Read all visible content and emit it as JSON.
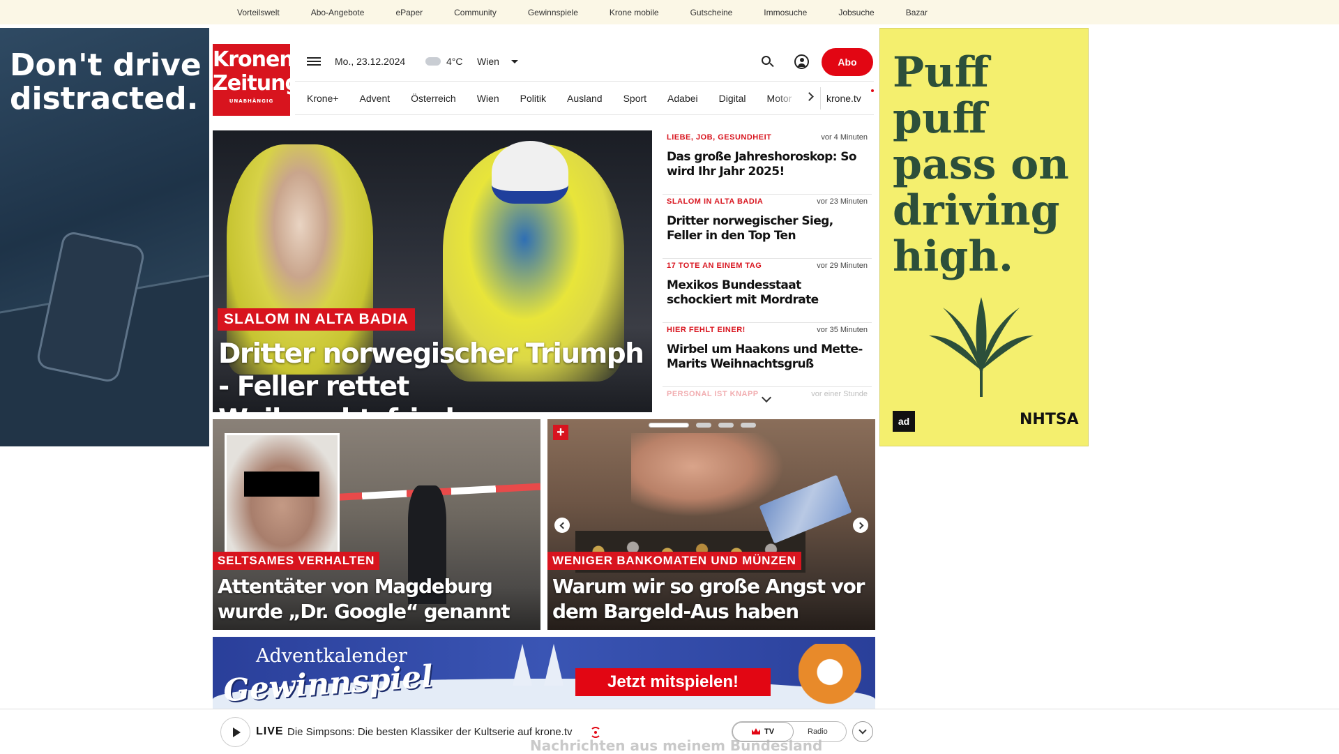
{
  "topbar": {
    "items": [
      "Vorteilswelt",
      "Abo-Angebote",
      "ePaper",
      "Community",
      "Gewinnspiele",
      "Krone mobile",
      "Gutscheine",
      "Immosuche",
      "Jobsuche",
      "Bazar"
    ]
  },
  "ad_left": {
    "title": "Don't drive distracted."
  },
  "ad_right": {
    "title": "Puff puff pass on driving high.",
    "badge": "ad",
    "brand": "NHTSA"
  },
  "header": {
    "logo_line1": "Kronen",
    "logo_line2": "Zeitung",
    "logo_tagline": "UNABHÄNGIG",
    "date": "Mo., 23.12.2024",
    "temperature": "4°C",
    "city": "Wien",
    "abo_label": "Abo"
  },
  "nav": {
    "items": [
      "Krone+",
      "Advent",
      "Österreich",
      "Wien",
      "Politik",
      "Ausland",
      "Sport",
      "Adabei",
      "Digital",
      "Motor"
    ],
    "extra": "krone.tv"
  },
  "hero": {
    "kicker": "SLALOM IN ALTA BADIA",
    "headline": "Dritter norwegischer Triumph - Feller rettet Weihnachtsfrieden"
  },
  "news_list": [
    {
      "kicker": "LIEBE, JOB, GESUNDHEIT",
      "time": "vor 4 Minuten",
      "title": "Das große Jahreshoroskop: So wird Ihr Jahr 2025!"
    },
    {
      "kicker": "SLALOM IN ALTA BADIA",
      "time": "vor 23 Minuten",
      "title": "Dritter norwegischer Sieg, Feller in den Top Ten"
    },
    {
      "kicker": "17 TOTE AN EINEM TAG",
      "time": "vor 29 Minuten",
      "title": "Mexikos Bundesstaat schockiert mit Mordrate"
    },
    {
      "kicker": "HIER FEHLT EINER!",
      "time": "vor 35 Minuten",
      "title": "Wirbel um Haakons und Mette-Marits Weihnachtsgruß"
    },
    {
      "kicker": "PERSONAL IST KNAPP",
      "time": "vor einer Stunde",
      "title": ""
    }
  ],
  "teasers": [
    {
      "kicker": "SELTSAMES VERHALTEN",
      "headline": "Attentäter von Magdeburg wurde „Dr. Google“ genannt"
    },
    {
      "badge": "+",
      "kicker": "WENIGER BANKOMATEN UND MÜNZEN",
      "headline": "Warum wir so große Angst vor dem Bargeld-Aus haben"
    }
  ],
  "advent": {
    "title": "Adventkalender",
    "subtitle": "Gewinnspiel",
    "cta": "Jetzt mitspielen!"
  },
  "player": {
    "live_label": "LIVE",
    "text": "Die Simpsons: Die besten Klassiker der Kultserie auf krone.tv",
    "tv_label": "TV",
    "radio_label": "Radio",
    "underlying_text": "Nachrichten aus meinem Bundesland"
  },
  "colors": {
    "brand_red": "#d8141e",
    "topbar_bg": "#fbf7e6",
    "ad_right_bg": "#f4ef6e"
  },
  "icons": [
    "menu-icon",
    "weather-cloud-icon",
    "chevron-down-icon",
    "search-icon",
    "user-icon",
    "chevron-right-icon",
    "play-icon",
    "broadcast-icon",
    "crown-icon"
  ]
}
